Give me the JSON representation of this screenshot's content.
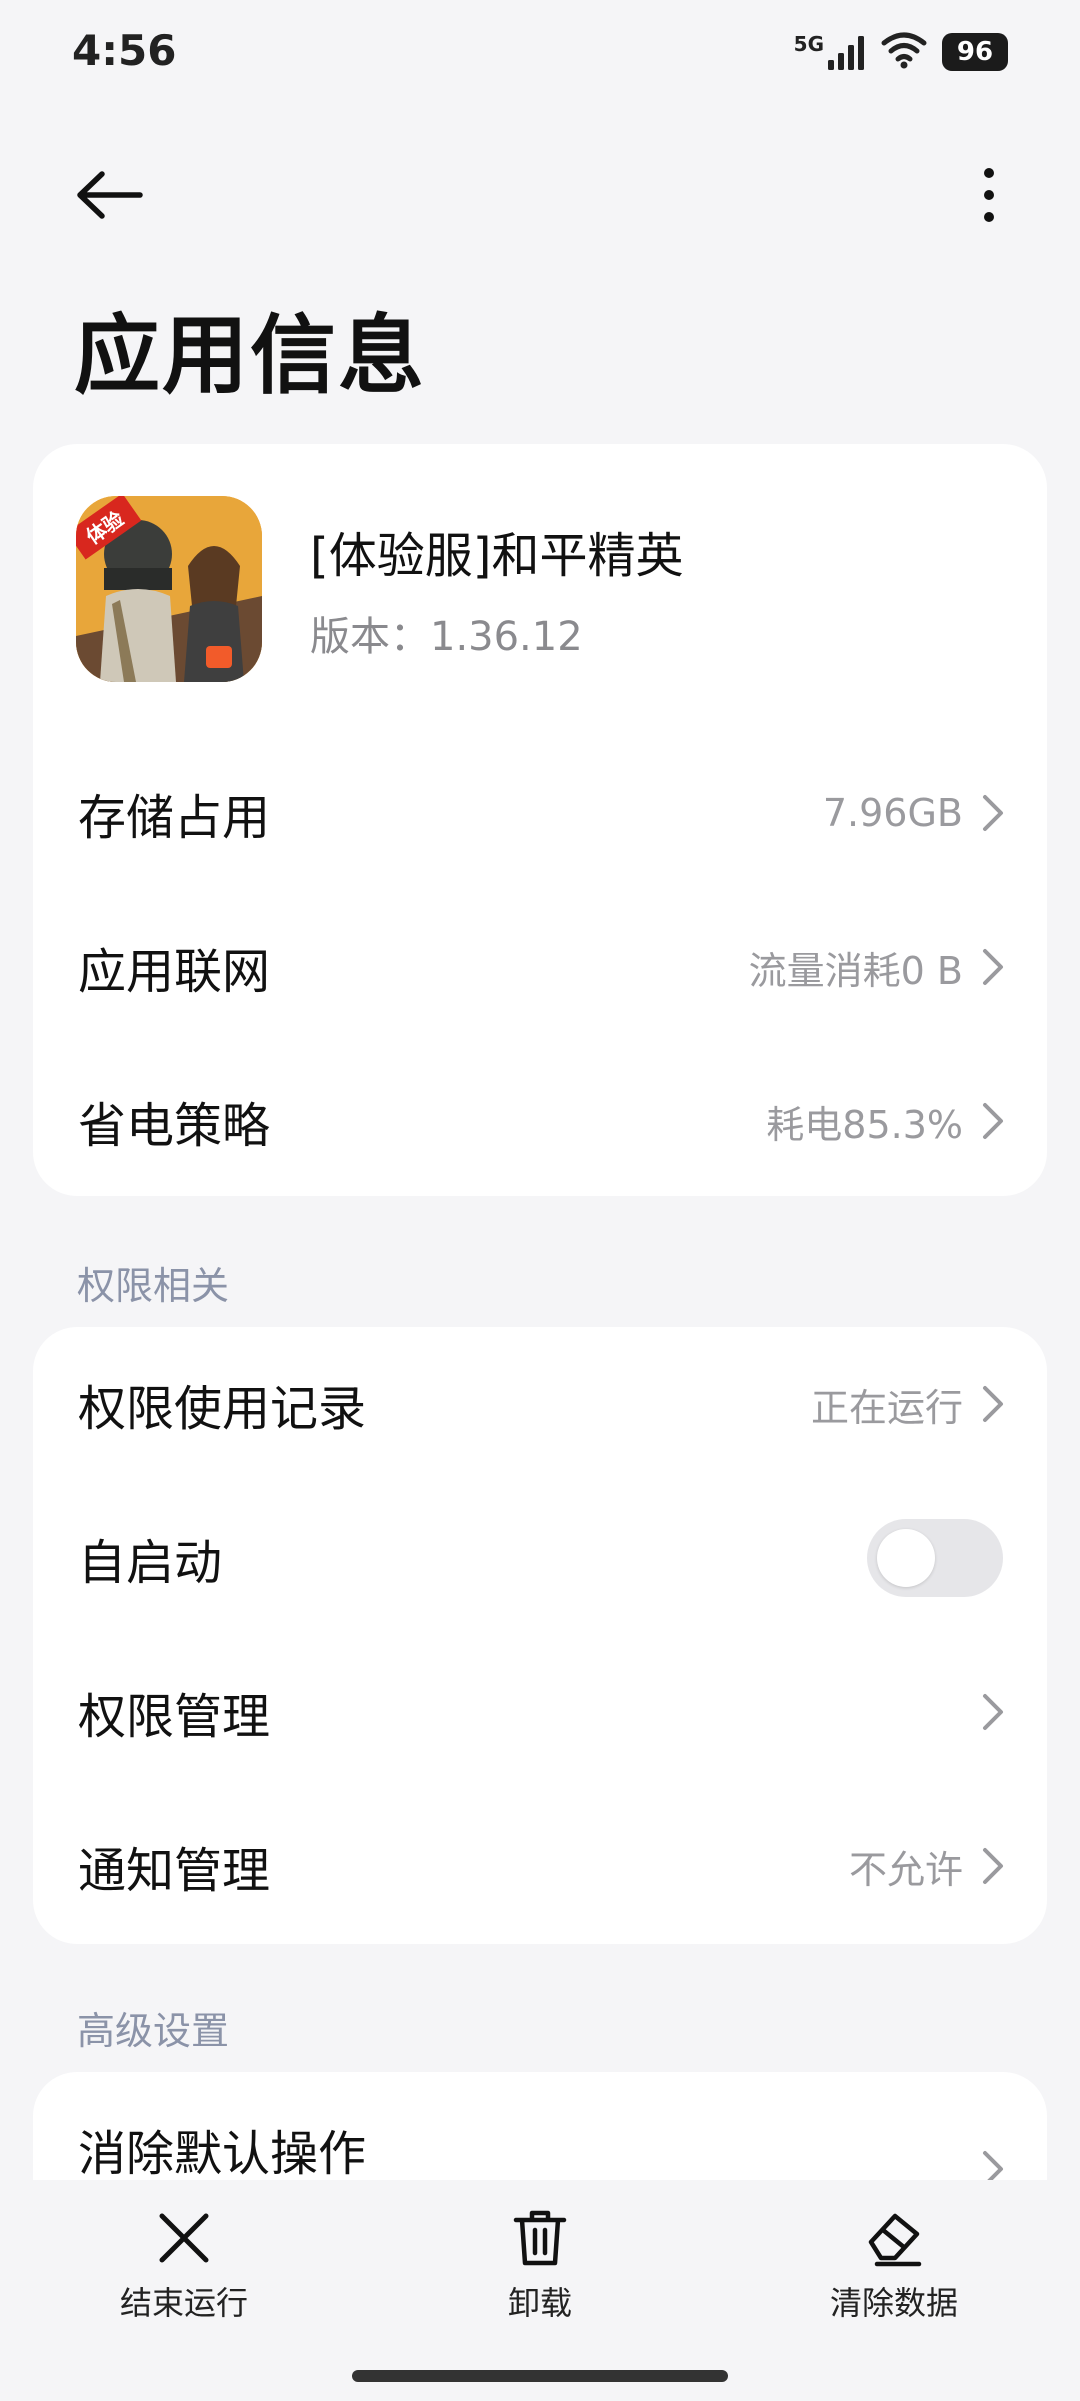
{
  "status_bar": {
    "time": "4:56",
    "network": "5G",
    "battery": "96"
  },
  "header": {
    "title": "应用信息"
  },
  "app": {
    "name": "[体验服]和平精英",
    "version": "版本：1.36.12",
    "icon_badge": "体验"
  },
  "main_rows": [
    {
      "label": "存储占用",
      "value": "7.96GB"
    },
    {
      "label": "应用联网",
      "value": "流量消耗0 B"
    },
    {
      "label": "省电策略",
      "value": "耗电85.3%"
    }
  ],
  "permissions": {
    "section_title": "权限相关",
    "rows": [
      {
        "label": "权限使用记录",
        "value": "正在运行"
      },
      {
        "label": "自启动",
        "toggle": false
      },
      {
        "label": "权限管理",
        "value": ""
      },
      {
        "label": "通知管理",
        "value": "不允许"
      }
    ]
  },
  "advanced": {
    "section_title": "高级设置",
    "rows": [
      {
        "label": "消除默认操作"
      }
    ]
  },
  "bottom_actions": [
    {
      "label": "结束运行",
      "icon": "close-icon"
    },
    {
      "label": "卸载",
      "icon": "trash-icon"
    },
    {
      "label": "清除数据",
      "icon": "eraser-icon"
    }
  ],
  "colors": {
    "background": "#f5f5f7",
    "card": "#ffffff",
    "section_label": "#8b93a8",
    "secondary_text": "#9a9a9e"
  }
}
